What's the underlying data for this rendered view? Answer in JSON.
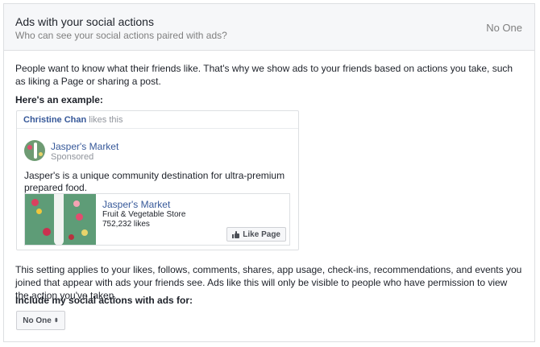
{
  "header": {
    "title": "Ads with your social actions",
    "subtitle": "Who can see your social actions paired with ads?",
    "current_value": "No One"
  },
  "intro": "People want to know what their friends like. That's why we show ads to your friends based on actions you take, such as liking a Page or sharing a post.",
  "example": {
    "label": "Here's an example:",
    "friend_name": "Christine Chan",
    "friend_action": "likes this",
    "page_name": "Jasper's Market",
    "sponsored": "Sponsored",
    "post_text": "Jasper's is a unique community destination for ultra-premium prepared food.",
    "attachment": {
      "title": "Jasper's Market",
      "category": "Fruit & Vegetable Store",
      "likes": "752,232 likes",
      "like_button": "Like Page"
    }
  },
  "setting_text": "This setting applies to your likes, follows, comments, shares, app usage, check-ins, recommendations, and events you joined that appear with ads your friends see. Ads like this will only be visible to people who have permission to view the action you've taken.",
  "include_label": "Include my social actions with ads for:",
  "dropdown": {
    "selected": "No One",
    "caret": "⬍"
  },
  "colors": {
    "link": "#365899",
    "muted": "#90949c",
    "header_bg": "#f6f7f9",
    "border": "#dddfe2",
    "image_green": "#5e9c77"
  }
}
